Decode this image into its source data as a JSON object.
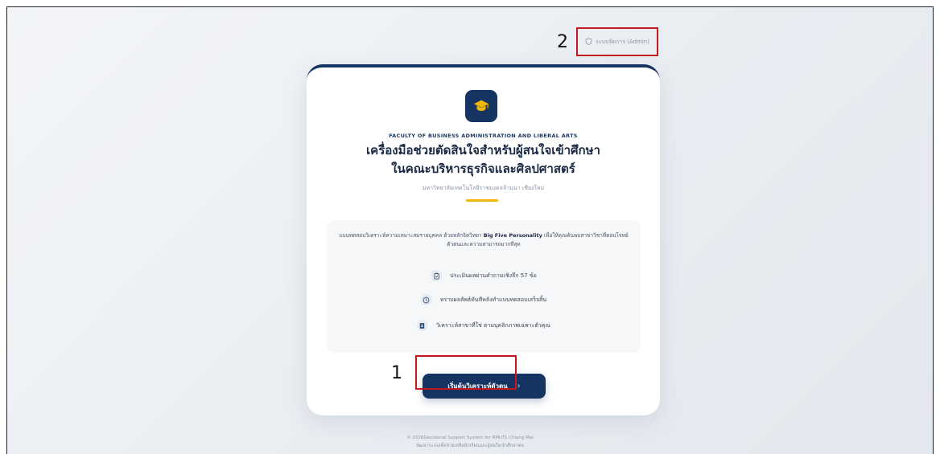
{
  "annotations": {
    "label_1": "1",
    "label_2": "2"
  },
  "header": {
    "admin_link": "ระบบจัดการ (Admin)",
    "admin_icon": "shield-icon"
  },
  "card": {
    "logo_icon": "graduation-cap-icon",
    "faculty": "FACULTY OF BUSINESS ADMINISTRATION AND LIBERAL ARTS",
    "title_line1": "เครื่องมือช่วยตัดสินใจสำหรับผู้สนใจเข้าศึกษา",
    "title_line2": "ในคณะบริหารธุรกิจและศิลปศาสตร์",
    "subtitle": "มหาวิทยาลัยเทคโนโลยีราชมงคลล้านนา เชียงใหม่",
    "description_pre": "แบบทดสอบวิเคราะห์ความเหมาะสมรายบุคคล ด้วยหลักจิตวิทยา ",
    "description_bold": "Big Five Personality",
    "description_post": " เพื่อให้คุณค้นพบสาขาวิชาที่ตอบโจทย์ตัวตนและความสามารถมากที่สุด",
    "features": [
      {
        "icon": "clipboard-icon",
        "label": "ประเมินผลผ่านคำถามเชิงลึก 57 ข้อ"
      },
      {
        "icon": "clock-icon",
        "label": "ทราบผลลัพธ์ทันทีหลังทำแบบทดสอบเสร็จสิ้น"
      },
      {
        "icon": "id-card-icon",
        "label": "วิเคราะห์สาขาที่ใช่ ตามบุคลิกภาพเฉพาะตัวคุณ"
      }
    ],
    "start_button": "เริ่มต้นวิเคราะห์ตัวตน",
    "start_chevron": "›"
  },
  "footer": {
    "line1": "© 2026Decisional Support System for RMUTL Chiang Mai",
    "line2": "พัฒนาระบบเพื่อช่วยเหลือนักเรียนและผู้สนใจเข้าศึกษาต่อ"
  },
  "colors": {
    "primary": "#163462",
    "accent": "#f2b705",
    "highlight": "#c4171e"
  }
}
